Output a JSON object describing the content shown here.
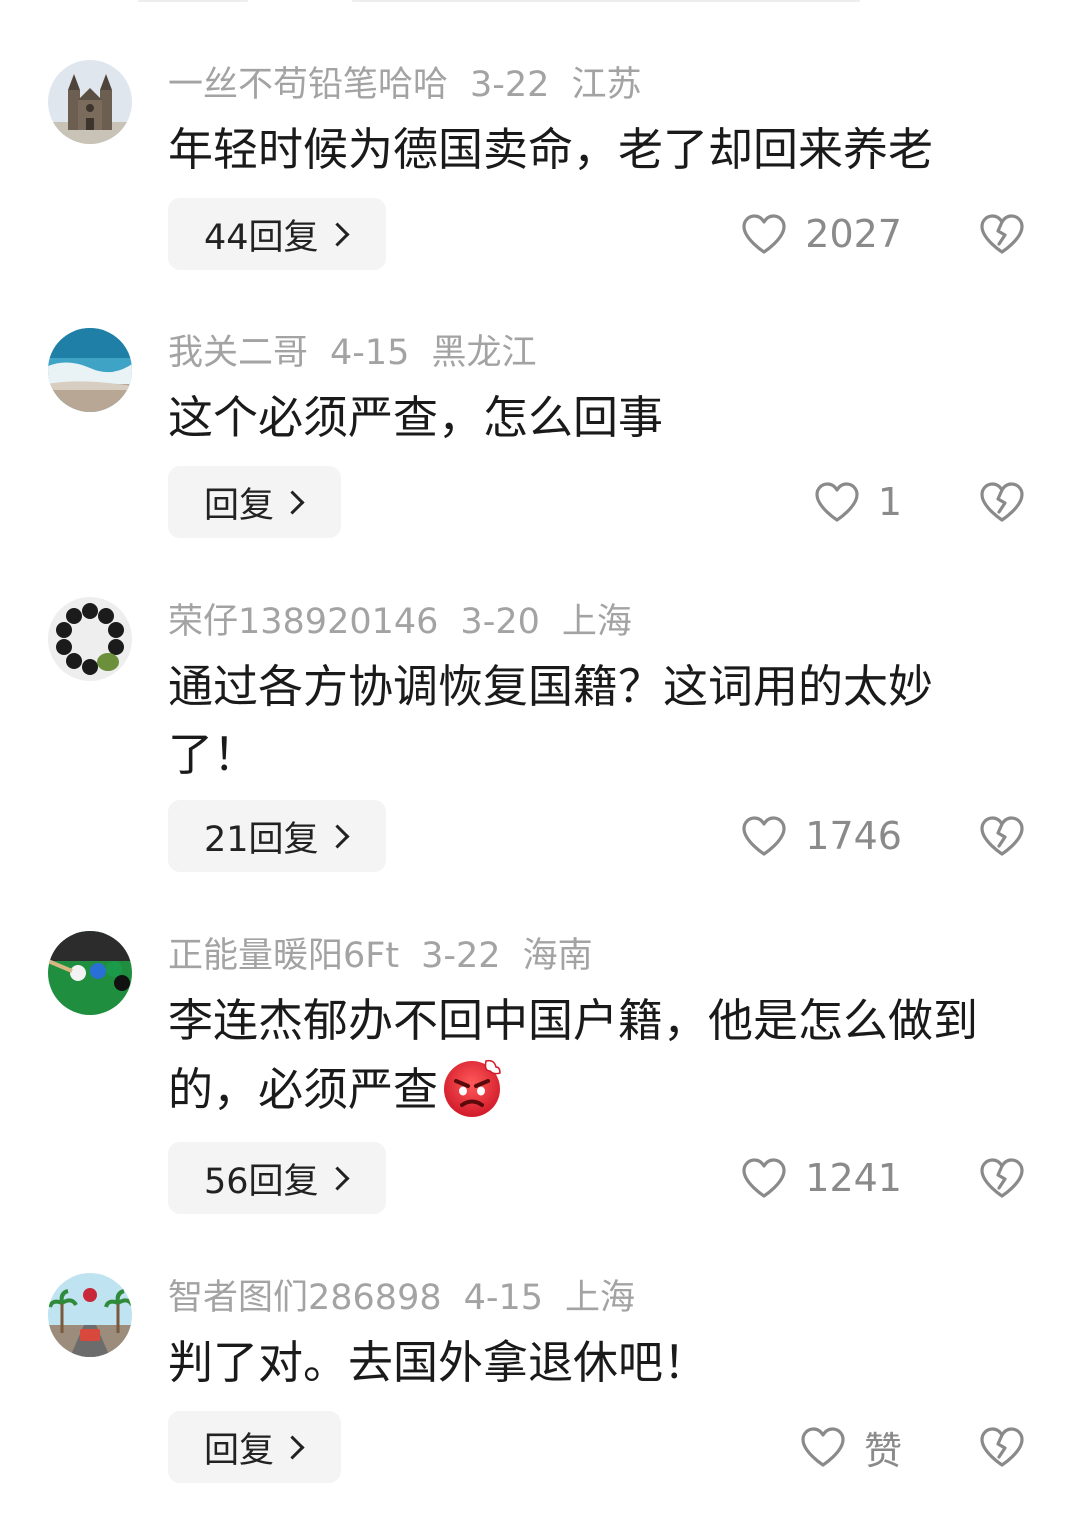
{
  "comments": [
    {
      "username": "一丝不苟铅笔哈哈",
      "date": "3-22",
      "location": "江苏",
      "text": "年轻时候为德国卖命，老了却回来养老",
      "replies": "44回复",
      "likes": "2027"
    },
    {
      "username": "我关二哥",
      "date": "4-15",
      "location": "黑龙江",
      "text": "这个必须严查，怎么回事",
      "replies": "回复",
      "likes": "1"
    },
    {
      "username": "荣仔138920146",
      "date": "3-20",
      "location": "上海",
      "text": "通过各方协调恢复国籍？这词用的太妙了！",
      "replies": "21回复",
      "likes": "1746"
    },
    {
      "username": "正能量暖阳6Ft",
      "date": "3-22",
      "location": "海南",
      "text": "李连杰郁办不回中国户籍，他是怎么做到的，必须严查",
      "replies": "56回复",
      "likes": "1241"
    },
    {
      "username": "智者图们286898",
      "date": "4-15",
      "location": "上海",
      "text": "判了对。去国外拿退休吧！",
      "replies": "回复",
      "likes": "赞"
    }
  ],
  "icons": {
    "like": "heart-outline-icon",
    "dislike": "broken-heart-icon",
    "reply_chevron": "chevron-right-icon",
    "emoji": "angry-face-emoji"
  },
  "colors": {
    "meta_text": "#a3a3a3",
    "body_text": "#1a1a1a",
    "reply_bg": "#f4f4f4",
    "icon_gray": "#8a8a8a"
  }
}
